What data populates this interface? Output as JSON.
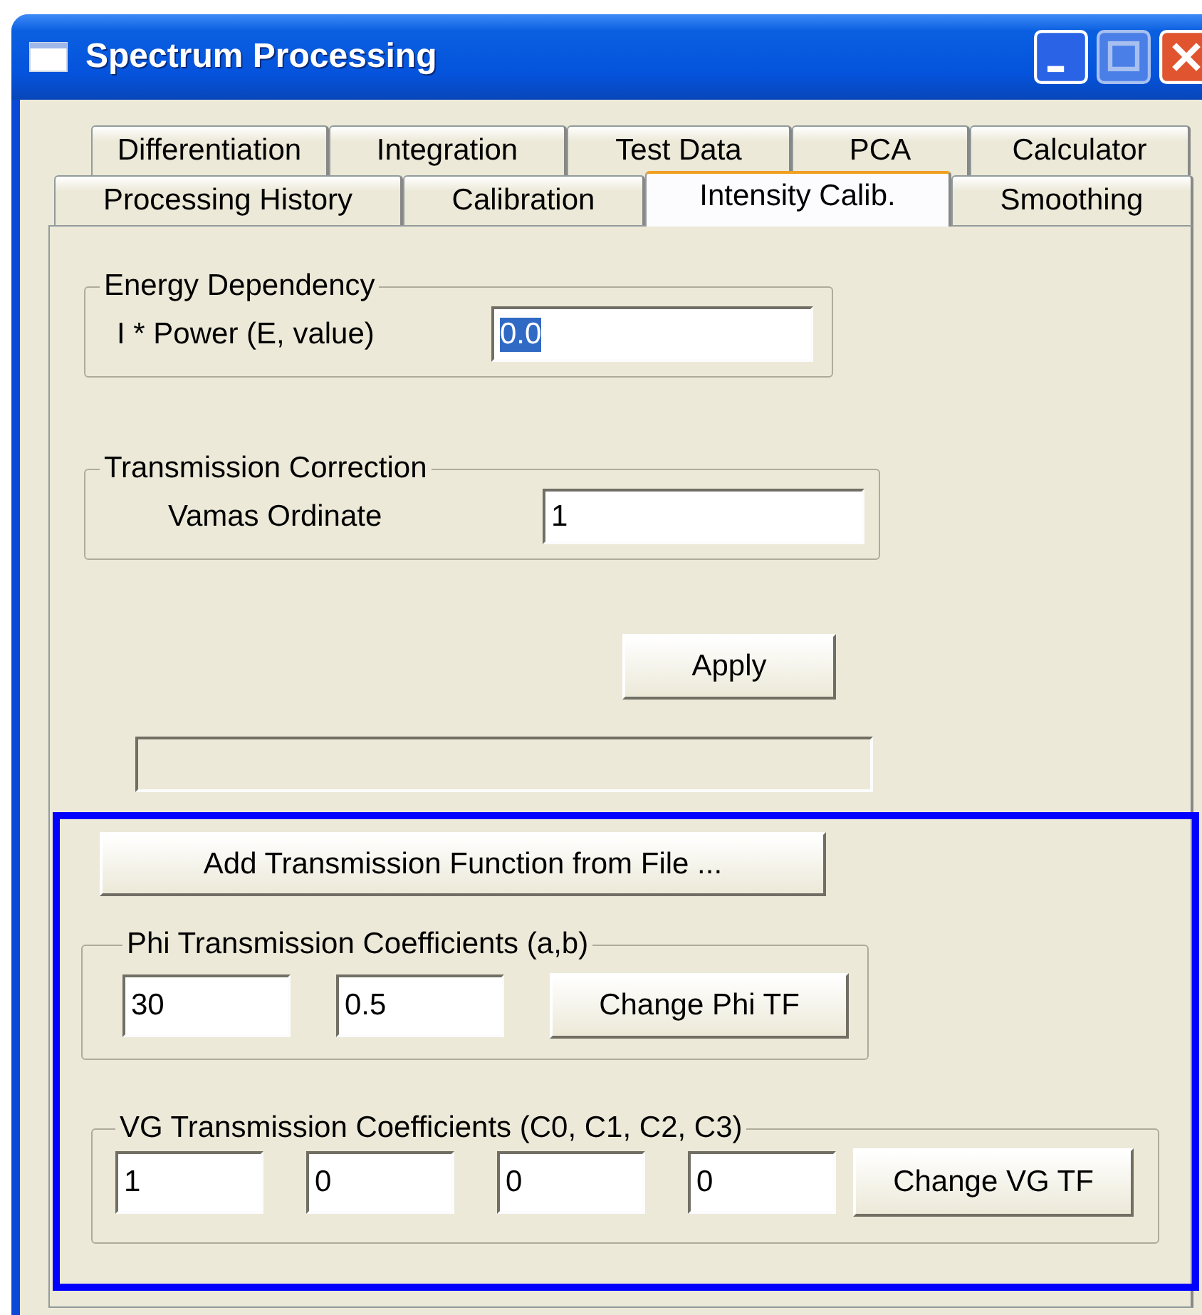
{
  "window": {
    "title": "Spectrum Processing"
  },
  "tab_rows": [
    [
      {
        "label": "Differentiation",
        "selected": false
      },
      {
        "label": "Integration",
        "selected": false
      },
      {
        "label": "Test Data",
        "selected": false
      },
      {
        "label": "PCA",
        "selected": false
      },
      {
        "label": "Calculator",
        "selected": false
      }
    ],
    [
      {
        "label": "Processing History",
        "selected": false
      },
      {
        "label": "Calibration",
        "selected": false
      },
      {
        "label": "Intensity Calib.",
        "selected": true
      },
      {
        "label": "Smoothing",
        "selected": false
      }
    ]
  ],
  "energy_dependency": {
    "title": "Energy Dependency",
    "label": "I * Power (E, value)",
    "value": "0.0",
    "value_selected": true
  },
  "transmission_correction": {
    "title": "Transmission Correction",
    "label": "Vamas Ordinate",
    "value": "1",
    "value_selected": false
  },
  "apply_button": "Apply",
  "progress": {
    "level": 0
  },
  "add_button": "Add Transmission Function from File ...",
  "phi": {
    "title": "Phi Transmission Coefficients (a,b)",
    "values": [
      "30",
      "0.5"
    ],
    "button": "Change Phi TF"
  },
  "vg": {
    "title": "VG Transmission Coefficients (C0, C1, C2, C3)",
    "values": [
      "1",
      "0",
      "0",
      "0"
    ],
    "button": "Change VG TF"
  }
}
